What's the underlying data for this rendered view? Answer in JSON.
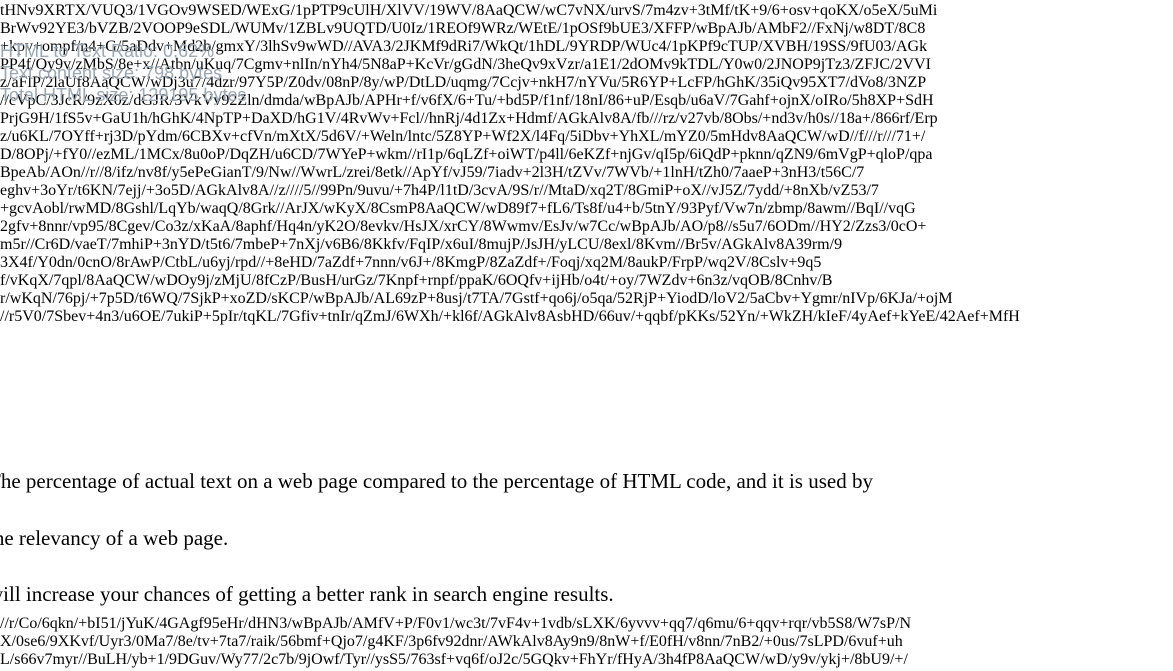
{
  "background_base64_top": [
    "tHNv9XRTX/VUQ3/1VGOv9WSED/WExG/1pPTP9cUlH/XlVV/19WV/8AaQCW/wC7vNX/urvS/7m4zv+3tMf/tK+9/6+osv+qoKX/o5eX/5uMi",
    "BrWv92YE3/bVZB/2VOOP9eSDL/WUMv/1ZBLv9UQTD/U0Iz/1REOf9WRz/WEtE/1pOSf9bUE3/XFFP/wBpAJb/AMbF2//FxNj/w8DT/8C8",
    "+kpv+ompf/n4+G/5aDdv+Md2b/gmxY/3lhSv9wWD//AVA3/2JKMf9dRi7/WkQt/1hDL/9YRDP/WUc4/1pKPf9cTUP/XVBH/19SS/9fU03/AGk",
    "PP4f/Qy9v/zMbS/8e+x//Atbn/uKuq/7Cgmv+nlIn/nYh4/5N8aP+KcVr/gGdN/3heQv9xVzr/a1E1/2dOMv9kTDL/Y0w0/2JNOP9jTz3/ZFJC/2VVI",
    "z/aFlP/2laUf8AaQCW/wDj3u7/4dzr/97Y5P/Z0dv/08nP/8y/wP/DtLD/uqmg/7Ccjv+nkH7/nYVu/5R6YP+LcFP/hGhK/35iQv95XT7/dVo8/3NZP",
    "//cVpC/3JcR/9zX0z/dGJR/3VkVv92Zln/dmda/wBpAJb/APHr+f/v6fX/6+Tu/+bd5P/f1nf/18nI/86+uP/Esqb/u6aV/7Gahf+ojnX/oIRo/5h8XP+SdH",
    "PrjG9H/1fS5v+GaU1h/hGhK/4NpTP+DaXD/hG1V/4RvWv+Fcl//hnRj/4d1Zx+Hdmf/AGkAlv8A/fb///rz/v27vb/8Obs/+nd3v/h0s//18a+/866rf/Erp",
    "z/u6KL/7OYff+rj3D/pYdm/6CBXv+cfVn/mXtX/5d6V/+Weln/lntc/5Z8YP+Wf2X/l4Fq/5iDbv+YhXL/mYZ0/5mHdv8AaQCW/wD//f///r///71+/",
    "D/8OPj/+fY0//ezML/1MCx/8u0oP/DqZH/u6CD/7WYeP+wkm//rI1p/6qLZf+oiWT/p4ll/6eKZf+njGv/qI5p/6iQdP+pknn/qZN9/6mVgP+qloP/qpa",
    "BpeAb/AOn//r//8/ifz/nv8f/y5ePeGianT/9/Nw//WwrL/zrei/8etk//ApYf/vJ59/7iadv+2l3H/tZVv/7WVb/+1lnH/tZh0/7aaeP+3nH3/t56C/7",
    "eghv+3oYr/t6KN/7ejj/+3o5D/AGkAlv8A//z////5//99Pn/9uvu/+7h4P/l1tD/3cvA/9S/r//MtaD/xq2T/8GmiP+oX//vJ5Z/7ydd/+8nXb/vZ53/7",
    "+gcvAobl/rwMD/8Gshl/LqYb/waqQ/8Grk//ArJX/wKyX/8CsmP8AaQCW/wD89f7+fL6/Ts8f/u4+b/5tnY/93Pyf/Vw7n/zbmp/8awm//BqI//vqG",
    "2gfv+8nnr/vp95/8Cgev/Co3z/xKaA/8aphf/Hq4n/yK2O/8evkv/HsJX/xrCY/8Wwmv/EsJv/w7Cc/wBpAJb/AO/p8//s5u7/6ODm//HY2/Zzs3/0cO+",
    "m5r//Cr6D/vaeT/7mhiP+3nYD/t5t6/7mbeP+7nXj/v6B6/8Kkfv/FqIP/x6uI/8mujP/JsJH/yLCU/8exl/8Kvm//Br5v/AGkAlv8A39rm/9",
    "3X4f/Y0dn/0cnO/8rAwP/CtbL/u6yj/rpd//+8eHD/7aZdf+7nnn/v6J+/8KmgP/8ZaZdf+/Foqj/xq2M/8aukP/FrpP/wq2V/8Cslv+9q5",
    "f/vKqX/7qpl/8AaQCW/wDOy9j/zMjU/8fCzP/BusH/urGz/7Knpf+rnpf/ppaK/6OQfv+ijHb/o4t/+oy/7WZdv+6n3z/vqOB/8Cnhv/B",
    "r/wKqN/76pj/+7p5D/t6WQ/7SjkP+xoZD/sKCP/wBpAJb/AL69zP+8usj/t7TA/7Gstf+qo6j/o5qa/52RjP+YiodD/loV2/5aCbv+Ygmr/nIVp/6KJa/+ojM",
    "//r5V0/7Sbev+4n3/u6OE/7ukiP+5pIr/tqKL/7Gfiv+tnIr/qZmJ/6WXh/+kl6f/AGkAlv8AsbHD/66uv/+qqbf/pKKs/52Yn/+WkZH/kIeF/4yAef+kYeE/42Aef+MfH"
  ],
  "background_base64_bottom": [
    "//r/Co/6qkn/+bI51/jYuK/4GAgf95eHr/dHN3/wBpAJb/AMfV+P/F0v1/wc3t/7vF4v+1vdb/sLXK/6yvvv+qq7/q6mu/6+qqv+rqr/vb5S8/W7sP/N",
    "X/0se6/9XKvf/Uyr3/0Ma7/8e/tv+7ta7/raik/56bmf+Qjo7/g4KF/3p6fv92dnr/AWkAlv8Ay9n9/8nW+f/E0fH/v8nn/7nB2/+0us/7sLPD/6vuf+uh",
    "L/s66v7myr//BuLH/yb+1/9DGuv/Wy77/2c7b/9jOwf/Tyr//ysS5/763sf+vq6f/oJ2c/5GQkv+FhYr/fHyA/3h4fP8AaQCW/wD/y9v/ykj+/8bU9/+/",
    "=="
  ],
  "overlay": {
    "line1": "HTML to Text Ratio: 0.62%",
    "line2": "Text content size: 798 bytes",
    "line3": "Total HTML size: 129195 bytes"
  },
  "paragraphs": [
    "The percentage of actual text on a web page compared to the percentage of HTML code, and it is used by",
    "the relevancy of a web page.",
    "will increase your chances of getting a better rank in search engine results."
  ]
}
